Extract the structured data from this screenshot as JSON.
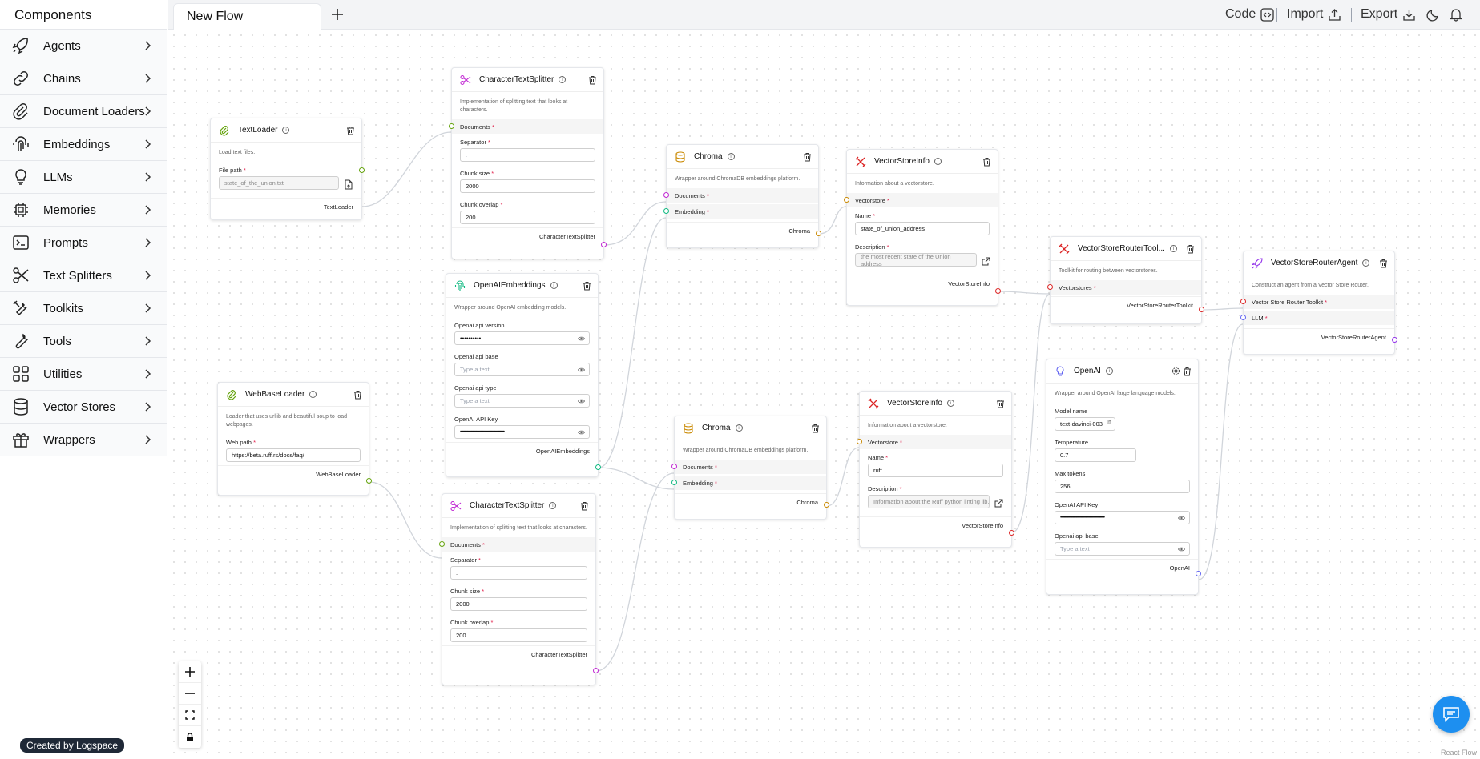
{
  "sidebar": {
    "title": "Components",
    "items": [
      {
        "label": "Agents",
        "icon": "rocket-icon"
      },
      {
        "label": "Chains",
        "icon": "link-icon"
      },
      {
        "label": "Document Loaders",
        "icon": "paperclip-icon"
      },
      {
        "label": "Embeddings",
        "icon": "fingerprint-icon"
      },
      {
        "label": "LLMs",
        "icon": "lightbulb-icon"
      },
      {
        "label": "Memories",
        "icon": "cpu-icon"
      },
      {
        "label": "Prompts",
        "icon": "terminal-icon"
      },
      {
        "label": "Text Splitters",
        "icon": "scissors-icon"
      },
      {
        "label": "Toolkits",
        "icon": "tools-icon"
      },
      {
        "label": "Tools",
        "icon": "wrench-icon"
      },
      {
        "label": "Utilities",
        "icon": "grid-icon"
      },
      {
        "label": "Vector Stores",
        "icon": "database-icon"
      },
      {
        "label": "Wrappers",
        "icon": "gift-icon"
      }
    ],
    "credit": "Created by Logspace"
  },
  "topbar": {
    "tab": "New Flow",
    "code": "Code",
    "import": "Import",
    "export": "Export"
  },
  "nodes": {
    "textloader": {
      "title": "TextLoader",
      "desc": "Load text files.",
      "file_label": "File path",
      "file_value": "state_of_the_union.txt",
      "output": "TextLoader"
    },
    "cts1": {
      "title": "CharacterTextSplitter",
      "desc": "Implementation of splitting text that looks at characters.",
      "documents": "Documents",
      "sep_label": "Separator",
      "sep_value": ".",
      "chunk_size_label": "Chunk size",
      "chunk_size": "2000",
      "chunk_overlap_label": "Chunk overlap",
      "chunk_overlap": "200",
      "output": "CharacterTextSplitter"
    },
    "chroma1": {
      "title": "Chroma",
      "desc": "Wrapper around ChromaDB embeddings platform.",
      "documents": "Documents",
      "embedding": "Embedding",
      "output": "Chroma"
    },
    "vsi1": {
      "title": "VectorStoreInfo",
      "desc": "Information about a vectorstore.",
      "vectorstore": "Vectorstore",
      "name_label": "Name",
      "name_value": "state_of_union_address",
      "desc_label": "Description",
      "desc_value": "the most recent state of the Union address",
      "output": "VectorStoreInfo"
    },
    "oaiemb": {
      "title": "OpenAIEmbeddings",
      "desc": "Wrapper around OpenAI embedding models.",
      "f1_label": "Openai api version",
      "f1_value": "••••••••••",
      "f2_label": "Openai api base",
      "f2_placeholder": "Type a text",
      "f3_label": "Openai api type",
      "f3_placeholder": "Type a text",
      "f4_label": "OpenAI API Key",
      "f4_value": "••••••••••••••••••••••••••••••••••••••••••••••••••",
      "output": "OpenAIEmbeddings"
    },
    "vsrt": {
      "title": "VectorStoreRouterTool...",
      "desc": "Toolkit for routing between vectorstores.",
      "vectorstores": "Vectorstores",
      "output": "VectorStoreRouterToolkit"
    },
    "vsra": {
      "title": "VectorStoreRouterAgent",
      "desc": "Construct an agent from a Vector Store Router.",
      "toolkit": "Vector Store Router Toolkit",
      "llm": "LLM",
      "output": "VectorStoreRouterAgent"
    },
    "webbase": {
      "title": "WebBaseLoader",
      "desc": "Loader that uses urllib and beautiful soup to load webpages.",
      "web_label": "Web path",
      "web_value": "https://beta.ruff.rs/docs/faq/",
      "output": "WebBaseLoader"
    },
    "cts2": {
      "title": "CharacterTextSplitter",
      "desc": "Implementation of splitting text that looks at characters.",
      "documents": "Documents",
      "sep_label": "Separator",
      "sep_value": ".",
      "chunk_size_label": "Chunk size",
      "chunk_size": "2000",
      "chunk_overlap_label": "Chunk overlap",
      "chunk_overlap": "200",
      "output": "CharacterTextSplitter"
    },
    "chroma2": {
      "title": "Chroma",
      "desc": "Wrapper around ChromaDB embeddings platform.",
      "documents": "Documents",
      "embedding": "Embedding",
      "output": "Chroma"
    },
    "vsi2": {
      "title": "VectorStoreInfo",
      "desc": "Information about a vectorstore.",
      "vectorstore": "Vectorstore",
      "name_label": "Name",
      "name_value": "ruff",
      "desc_label": "Description",
      "desc_value": "Information about the Ruff python linting lib...",
      "output": "VectorStoreInfo"
    },
    "openai": {
      "title": "OpenAI",
      "desc": "Wrapper around OpenAI large language models.",
      "model_label": "Model name",
      "model_value": "text-davinci-003",
      "temp_label": "Temperature",
      "temp_value": "0.7",
      "max_label": "Max tokens",
      "max_value": "256",
      "key_label": "OpenAI API Key",
      "key_value": "••••••••••••••••••••••••••••••••••••••••••••••••••",
      "base_label": "Openai api base",
      "base_placeholder": "Type a text",
      "output": "OpenAI"
    }
  },
  "attribution": "React Flow",
  "colors": {
    "accent": "#1d8ff0",
    "required": "#e11d48"
  }
}
